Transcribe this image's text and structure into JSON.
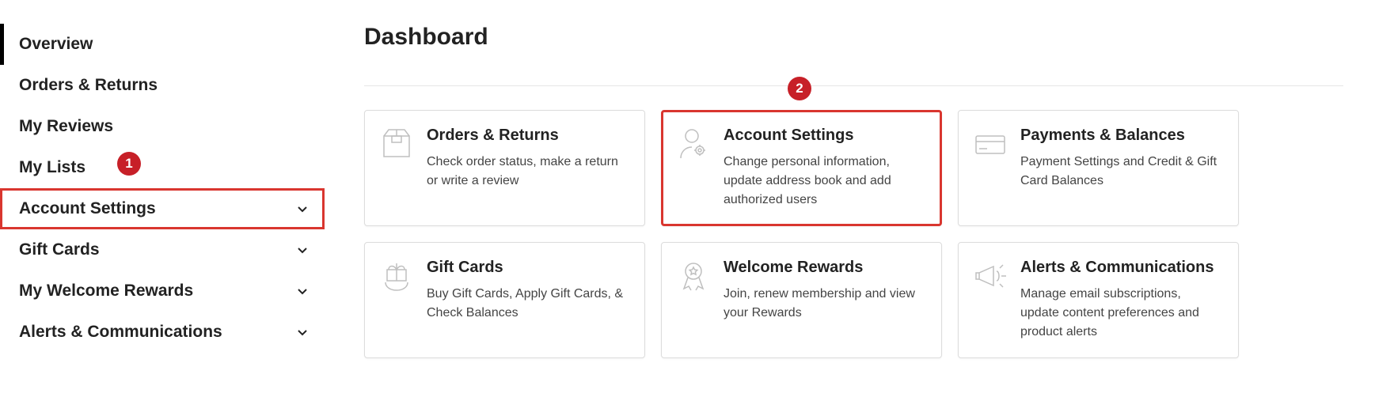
{
  "sidebar": {
    "items": [
      {
        "label": "Overview",
        "active": true,
        "expandable": false
      },
      {
        "label": "Orders & Returns",
        "expandable": false
      },
      {
        "label": "My Reviews",
        "expandable": false
      },
      {
        "label": "My Lists",
        "expandable": false
      },
      {
        "label": "Account Settings",
        "expandable": true,
        "highlighted": true
      },
      {
        "label": "Gift Cards",
        "expandable": true
      },
      {
        "label": "My Welcome Rewards",
        "expandable": true
      },
      {
        "label": "Alerts & Communications",
        "expandable": true
      }
    ]
  },
  "annotations": {
    "badge1": "1",
    "badge2": "2"
  },
  "main": {
    "title": "Dashboard",
    "cards": [
      {
        "title": "Orders & Returns",
        "desc": "Check order status, make a return or write a review",
        "icon": "package-icon"
      },
      {
        "title": "Account Settings",
        "desc": "Change personal information, update address book and add authorized users",
        "icon": "person-gear-icon",
        "highlighted": true
      },
      {
        "title": "Payments & Balances",
        "desc": "Payment Settings and Credit & Gift Card Balances",
        "icon": "card-icon"
      },
      {
        "title": "Gift Cards",
        "desc": "Buy Gift Cards, Apply Gift Cards, & Check Balances",
        "icon": "gift-icon"
      },
      {
        "title": "Welcome Rewards",
        "desc": "Join, renew membership and view your Rewards",
        "icon": "ribbon-icon"
      },
      {
        "title": "Alerts & Communications",
        "desc": "Manage email subscriptions, update content preferences and product alerts",
        "icon": "megaphone-icon"
      }
    ]
  }
}
